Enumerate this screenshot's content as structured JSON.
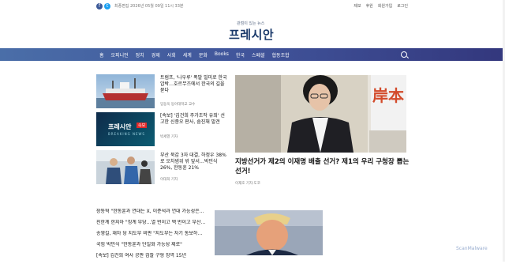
{
  "topbar": {
    "facebook_icon": "f",
    "twitter_icon": "t",
    "last_modified": "최종편집 2026년 05월 09일 11시 33분",
    "links": [
      "제보",
      "후원",
      "회원가입",
      "로그인"
    ]
  },
  "logo": {
    "tagline": "관점이 있는 뉴스",
    "brand": "프레시안"
  },
  "nav": {
    "items": [
      "홈",
      "오피니언",
      "정치",
      "경제",
      "사회",
      "세계",
      "문화",
      "Books",
      "한국",
      "스페셜",
      "협동조합"
    ]
  },
  "cards": [
    {
      "title": "트럼프, '나우루' 폭발 빌미로 한국 압박…호르무즈에서 한국의 길을 묻다",
      "author": "임동욱 동아대학교 교수"
    },
    {
      "title": "[속보] '김건희 주가조작 유죄' 선고한 신종오 판사, 숨진채 발견",
      "author": "박세열 기자",
      "image_brand": "프레시안",
      "image_badge": "속보",
      "image_sub": "BREAKING NEWS"
    },
    {
      "title": "부산 북갑 3자 대결, 하정우 38%로 오차범위 밖 앞서…박민식 26%, 한동훈 21%",
      "author": "이대희 기자"
    }
  ],
  "hero": {
    "title": "지방선거가 제2의 이재명 배출 선거? 제1의 우리 구청장 뽑는 선거!",
    "author": "이재호 기자·도코",
    "sign_text": "岸本"
  },
  "list": [
    "장동혁 \"한동훈과 연대는 X, 이준석과 연대 가능성은…",
    "친한계 한지아 \"징계 부당…열 번이고 백 번이고 부산…",
    "송영길, 재차 당 지도부 비판 \"지도부는 자기 통보하…",
    "국힘 박민식 \"한동훈과 단일화 가능성 제로\"",
    "[속보] 김건희 여사 공판 검찰 구형 징역 15년"
  ],
  "watermark": "ScanMalware",
  "colors": {
    "brand": "#1b3a6b",
    "nav_start": "#4a6ea8",
    "nav_end": "#33377d",
    "breaking_badge": "#e02a2a"
  }
}
